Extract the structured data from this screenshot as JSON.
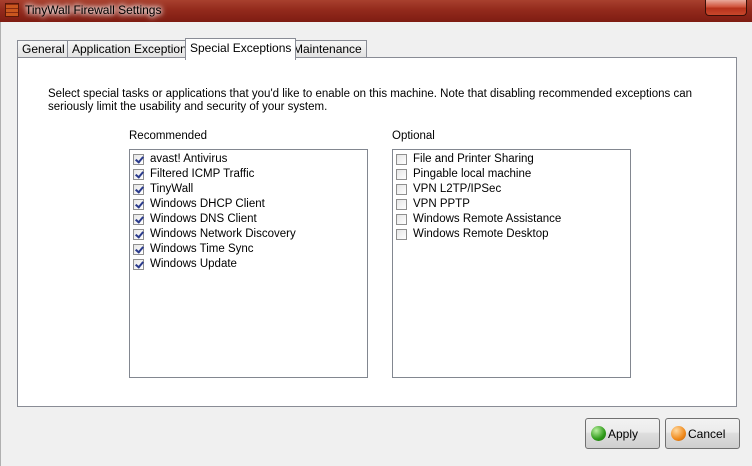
{
  "window": {
    "title": "TinyWall Firewall Settings"
  },
  "tabs": [
    {
      "label": "General"
    },
    {
      "label": "Application Exceptions"
    },
    {
      "label": "Special Exceptions"
    },
    {
      "label": "Maintenance"
    }
  ],
  "active_tab": "Special Exceptions",
  "description": "Select special tasks or applications that you'd like to enable on this machine. Note that disabling recommended exceptions can seriously limit the usability and security of your system.",
  "recommended": {
    "label": "Recommended",
    "items": [
      {
        "label": "avast! Antivirus",
        "checked": true
      },
      {
        "label": "Filtered ICMP Traffic",
        "checked": true
      },
      {
        "label": "TinyWall",
        "checked": true
      },
      {
        "label": "Windows DHCP Client",
        "checked": true
      },
      {
        "label": "Windows DNS Client",
        "checked": true
      },
      {
        "label": "Windows Network Discovery",
        "checked": true
      },
      {
        "label": "Windows Time Sync",
        "checked": true
      },
      {
        "label": "Windows Update",
        "checked": true
      }
    ]
  },
  "optional": {
    "label": "Optional",
    "items": [
      {
        "label": "File and Printer Sharing",
        "checked": false
      },
      {
        "label": "Pingable local machine",
        "checked": false
      },
      {
        "label": "VPN L2TP/IPSec",
        "checked": false
      },
      {
        "label": "VPN PPTP",
        "checked": false
      },
      {
        "label": "Windows Remote Assistance",
        "checked": false
      },
      {
        "label": "Windows Remote Desktop",
        "checked": false
      }
    ]
  },
  "buttons": {
    "apply": "Apply",
    "cancel": "Cancel"
  },
  "colors": {
    "titlebar": "#932a1c",
    "apply_icon": "#2f9a1a",
    "cancel_icon": "#f08a1c"
  }
}
